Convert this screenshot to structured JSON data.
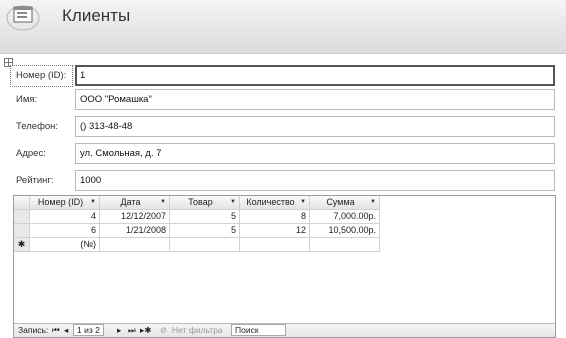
{
  "form": {
    "title": "Клиенты"
  },
  "fields": [
    {
      "label": "Номер (ID):",
      "value": "1"
    },
    {
      "label": "Имя:",
      "value": "ООО \"Ромашка\""
    },
    {
      "label": "Телефон:",
      "value": "() 313-48-48"
    },
    {
      "label": "Адрес:",
      "value": "ул. Смольная, д. 7"
    },
    {
      "label": "Рейтинг:",
      "value": "1000"
    }
  ],
  "subform": {
    "columns": [
      "Номер (ID)",
      "Дата",
      "Товар",
      "Количество",
      "Сумма"
    ],
    "rows": [
      [
        "4",
        "12/12/2007",
        "5",
        "8",
        "7,000.00р."
      ],
      [
        "6",
        "1/21/2008",
        "5",
        "12",
        "10,500.00р."
      ]
    ],
    "new_row_marker": "✱",
    "new_row_id": "(№)"
  },
  "navigation": {
    "record_label": "Запись:",
    "first_icon": "⏮",
    "prev_icon": "◂",
    "position": "1 из 2",
    "next_icon": "▸",
    "last_icon": "⏭",
    "new_icon": "▸✱",
    "filter_label": "Нет фильтра",
    "search_label": "Поиск"
  }
}
